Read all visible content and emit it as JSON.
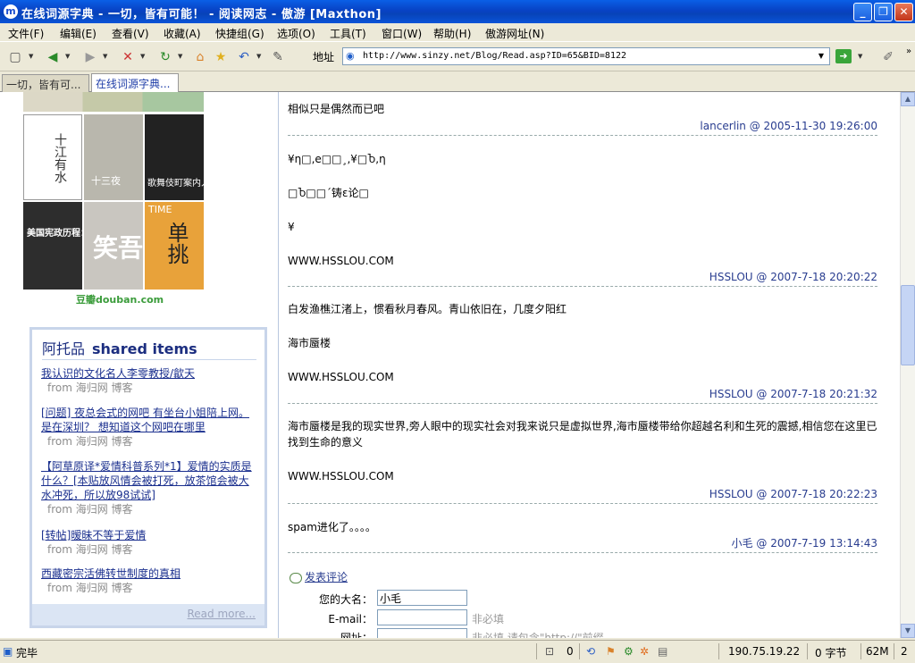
{
  "window": {
    "title": "在线词源字典 - 一切，皆有可能！ - 阅读网志 - 傲游 [Maxthon]",
    "app_icon": "m",
    "btn_minimize": "_",
    "btn_maximize": "❐",
    "btn_close": "✕"
  },
  "menu": [
    "文件(F)",
    "编辑(E)",
    "查看(V)",
    "收藏(A)",
    "快捷组(G)",
    "选项(O)",
    "工具(T)",
    "窗口(W)",
    "帮助(H)",
    "傲游网址(N)"
  ],
  "toolbar": {
    "address_label": "地址",
    "url": "http://www.sinzy.net/Blog/Read.asp?ID=65&BID=8122"
  },
  "tabs": [
    "一切，皆有可...",
    "在线词源字典..."
  ],
  "sidebar": {
    "covers": [
      {
        "label": "十三夜",
        "bg": "#b9b7ad"
      },
      {
        "label": "歌舞伎町案内人",
        "bg": "#b03a2e"
      },
      {
        "label": "美国宪政历程：",
        "bg": "#2d2d2d"
      },
      {
        "label": "笑吾",
        "bg": "#c9c6c0"
      },
      {
        "label": "单挑",
        "bg": "#e8a23a"
      }
    ],
    "cover_caption": "TIME",
    "douban": "豆瓣douban.com",
    "shared_title_cn": "阿托品",
    "shared_title_en": "shared items",
    "shared_items": [
      {
        "title": "我认识的文化名人李零教授/歙天",
        "from": "from 海归网 博客"
      },
      {
        "title": "[问题] 夜总会式的网吧 有坐台小姐陪上网。是在深圳？ 想知道这个网吧在哪里",
        "from": "from 海归网 博客"
      },
      {
        "title": "【阿草原译*爱情科普系列*1】爱情的实质是什么？[本贴放风情会被打死，放茶馆会被大水冲死，所以放98试试]",
        "from": "from 海归网 博客"
      },
      {
        "title": "[转帖]暧昧不等于爱情",
        "from": "from 海归网 博客"
      },
      {
        "title": "西藏密宗活佛转世制度的真相",
        "from": "from 海归网 博客"
      }
    ],
    "read_more": "Read more..."
  },
  "comments": [
    {
      "lines": [
        "相似只是偶然而已吧"
      ],
      "author": "lancerlin",
      "time": "2005-11-30 19:26:00"
    },
    {
      "lines": [
        "¥η□,e□□¸,¥□Ⴆ,η",
        "",
        "□Ⴆ□□´铸ɛ论□",
        "",
        "¥",
        "",
        "WWW.HSSLOU.COM"
      ],
      "author": "HSSLOU",
      "time": "2007-7-18 20:20:22"
    },
    {
      "lines": [
        "白发渔樵江渚上，惯看秋月春风。青山依旧在，几度夕阳红",
        "",
        "海市蜃楼",
        "",
        "WWW.HSSLOU.COM"
      ],
      "author": "HSSLOU",
      "time": "2007-7-18 20:21:32"
    },
    {
      "lines": [
        "海市蜃楼是我的现实世界,旁人眼中的现实社会对我来说只是虚拟世界,海市蜃楼带给你超越名利和生死的震撼,相信您在这里已找到生命的意义",
        "",
        "WWW.HSSLOU.COM"
      ],
      "author": "HSSLOU",
      "time": "2007-7-18 20:22:23"
    },
    {
      "lines": [
        "spam进化了。。。。"
      ],
      "author": "小毛",
      "time": "2007-7-19 13:14:43"
    }
  ],
  "form": {
    "post_link": "发表评论",
    "name_label": "您的大名：",
    "name_value": "小毛",
    "email_label": "E-mail：",
    "email_hint": "非必填",
    "url_label": "网址：",
    "url_hint": "非必填 请包含\"http://\"前缀"
  },
  "status": {
    "text": "完毕",
    "count": "0",
    "ip": "190.75.19.22",
    "bytes": "0 字节",
    "mem": "62M",
    "num": "2"
  }
}
